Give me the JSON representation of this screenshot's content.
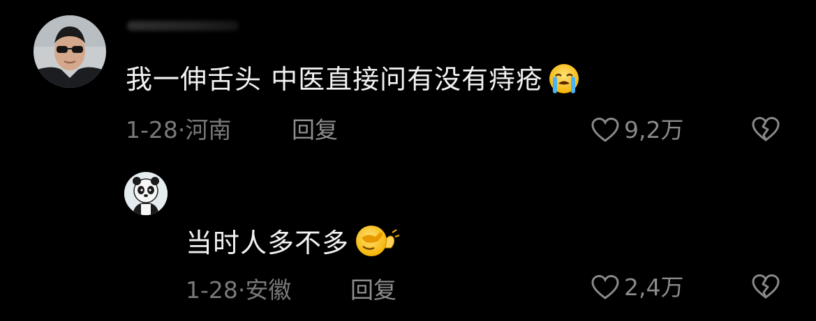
{
  "comments": [
    {
      "text": "我一伸舌头 中医直接问有没有痔疮",
      "emoji": "loudly-crying-face-emoji",
      "date": "1-28",
      "separator": "·",
      "location": "河南",
      "reply_label": "回复",
      "likes": "9,2万"
    },
    {
      "text": "当时人多不多",
      "emoji": "face-palm-emoji",
      "date": "1-28",
      "separator": "·",
      "location": "安徽",
      "reply_label": "回复",
      "likes": "2,4万"
    }
  ],
  "icons": {
    "like": "heart-outline-icon",
    "dislike": "broken-heart-icon"
  },
  "colors": {
    "background": "#000000",
    "text": "#f2f2f2",
    "meta": "#7a7a7a",
    "icon": "#8a8a8a"
  }
}
